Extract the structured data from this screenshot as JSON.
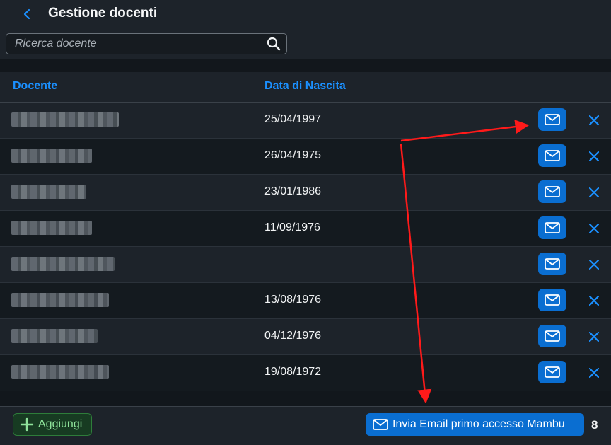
{
  "header": {
    "title": "Gestione docenti",
    "back_icon": "chevron-left-icon"
  },
  "search": {
    "placeholder": "Ricerca docente",
    "value": "",
    "icon": "search-icon"
  },
  "table": {
    "columns": [
      "Docente",
      "Data di Nascita"
    ],
    "rows": [
      {
        "date": "25/04/1997"
      },
      {
        "date": "26/04/1975"
      },
      {
        "date": "23/01/1986"
      },
      {
        "date": "11/09/1976"
      },
      {
        "date": ""
      },
      {
        "date": "13/08/1976"
      },
      {
        "date": "04/12/1976"
      },
      {
        "date": "19/08/1972"
      }
    ],
    "row_action_icons": [
      "mail-icon",
      "close-icon"
    ]
  },
  "footer": {
    "add_label": "Aggiungi",
    "send_label": "Invia Email primo accesso Mambu",
    "count": "8"
  },
  "colors": {
    "accent": "#1b90ff",
    "button_blue": "#0a6ed1",
    "add_green": "#8fe39b",
    "annotation_red": "#ff1a1a",
    "background": "#12171c",
    "bar": "#1d232a"
  }
}
